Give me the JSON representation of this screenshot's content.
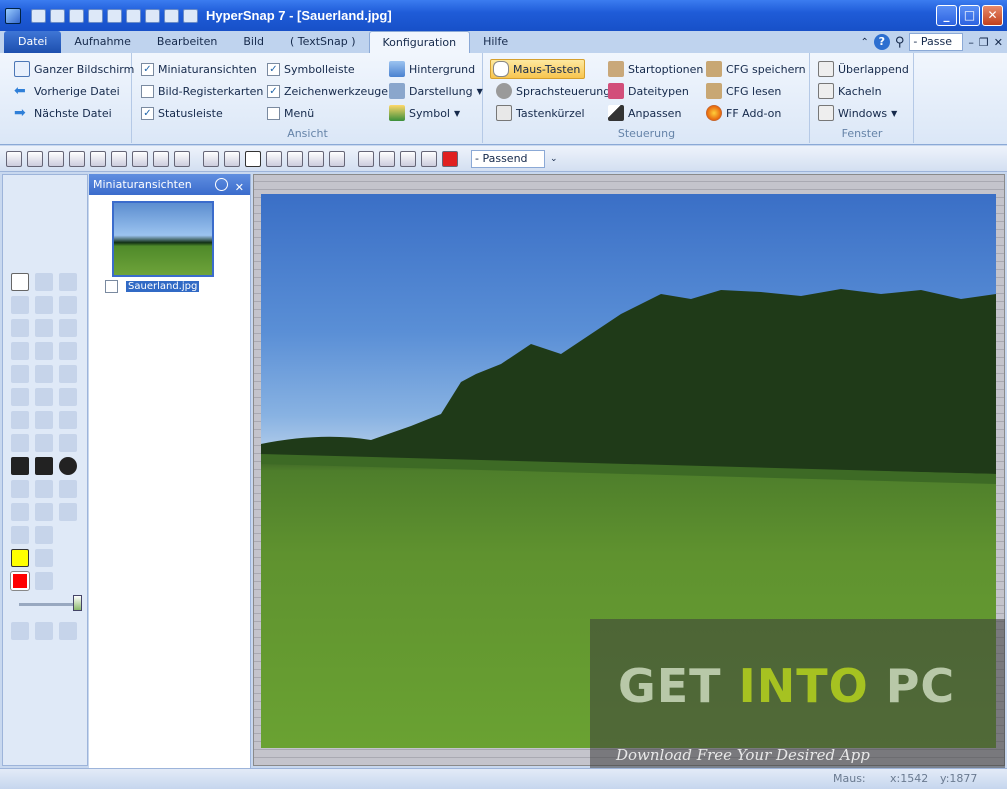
{
  "window": {
    "title": "HyperSnap 7 - [Sauerland.jpg]"
  },
  "tabs": [
    {
      "label": "Datei"
    },
    {
      "label": "Aufnahme"
    },
    {
      "label": "Bearbeiten"
    },
    {
      "label": "Bild"
    },
    {
      "label": "( TextSnap )"
    },
    {
      "label": "Konfiguration"
    },
    {
      "label": "Hilfe"
    }
  ],
  "tabbar_right": {
    "zoom_label": "- Passe"
  },
  "ribbon": {
    "nav": {
      "full_screen": "Ganzer Bildschirm",
      "prev_file": "Vorherige Datei",
      "next_file": "Nächste Datei"
    },
    "view": {
      "thumbnails": "Miniaturansichten",
      "tabs": "Bild-Registerkarten",
      "statusbar": "Statusleiste",
      "symbolbar": "Symbolleiste",
      "drawtools": "Zeichenwerkzeuge",
      "menu": "Menü",
      "background": "Hintergrund",
      "display": "Darstellung",
      "symbol": "Symbol",
      "group_label": "Ansicht"
    },
    "control": {
      "mouse_keys": "Maus-Tasten",
      "voice": "Sprachsteuerung",
      "shortcuts": "Tastenkürzel",
      "startoptions": "Startoptionen",
      "filetypes": "Dateitypen",
      "customize": "Anpassen",
      "cfg_save": "CFG speichern",
      "cfg_read": "CFG lesen",
      "ff_addon": "FF Add-on",
      "group_label": "Steuerung"
    },
    "window": {
      "overlap": "Überlappend",
      "tile": "Kacheln",
      "windows": "Windows",
      "group_label": "Fenster"
    }
  },
  "toolbar": {
    "fit_value": "- Passend"
  },
  "thumbnail_pane": {
    "title": "Miniaturansichten",
    "filename": "Sauerland.jpg"
  },
  "watermark": {
    "title_a": "GET ",
    "title_b": "INTO",
    "title_c": " PC",
    "subtitle": "Download Free Your Desired App"
  },
  "statusbar": {
    "mouse_label": "Maus:",
    "x": "x:1542",
    "y": "y:1877"
  },
  "colors": {
    "accent": "#3b6ccc",
    "highlight": "#f8c54f",
    "current_color": "#ff0000"
  },
  "icons": [
    "app-icon",
    "new-icon",
    "open-icon",
    "save-icon",
    "upload-icon",
    "print-icon",
    "undo-icon",
    "redo-icon"
  ]
}
